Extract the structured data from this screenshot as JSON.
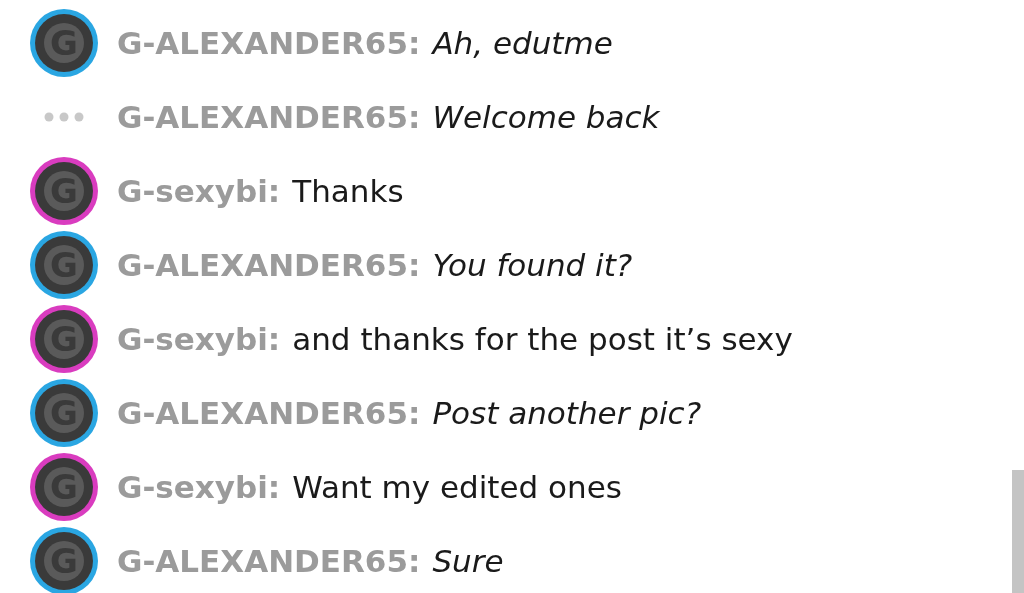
{
  "messages": [
    {
      "avatar": {
        "kind": "letter",
        "letter": "G",
        "color": "#2aa6e2"
      },
      "name": "G-ALEXANDER65:",
      "text": "Ah, edutme",
      "italic": true
    },
    {
      "avatar": {
        "kind": "typing"
      },
      "name": "G-ALEXANDER65:",
      "text": "Welcome back",
      "italic": true
    },
    {
      "avatar": {
        "kind": "letter",
        "letter": "G",
        "color": "#d93cbf"
      },
      "name": "G-sexybi:",
      "text": "Thanks",
      "italic": false
    },
    {
      "avatar": {
        "kind": "letter",
        "letter": "G",
        "color": "#2aa6e2"
      },
      "name": "G-ALEXANDER65:",
      "text": "You found it?",
      "italic": true
    },
    {
      "avatar": {
        "kind": "letter",
        "letter": "G",
        "color": "#d93cbf"
      },
      "name": "G-sexybi:",
      "text": "and thanks for the post it’s sexy",
      "italic": false
    },
    {
      "avatar": {
        "kind": "letter",
        "letter": "G",
        "color": "#2aa6e2"
      },
      "name": "G-ALEXANDER65:",
      "text": "Post another pic?",
      "italic": true
    },
    {
      "avatar": {
        "kind": "letter",
        "letter": "G",
        "color": "#d93cbf"
      },
      "name": "G-sexybi:",
      "text": "Want my edited ones",
      "italic": false
    },
    {
      "avatar": {
        "kind": "letter",
        "letter": "G",
        "color": "#2aa6e2"
      },
      "name": "G-ALEXANDER65:",
      "text": "Sure",
      "italic": true
    }
  ]
}
